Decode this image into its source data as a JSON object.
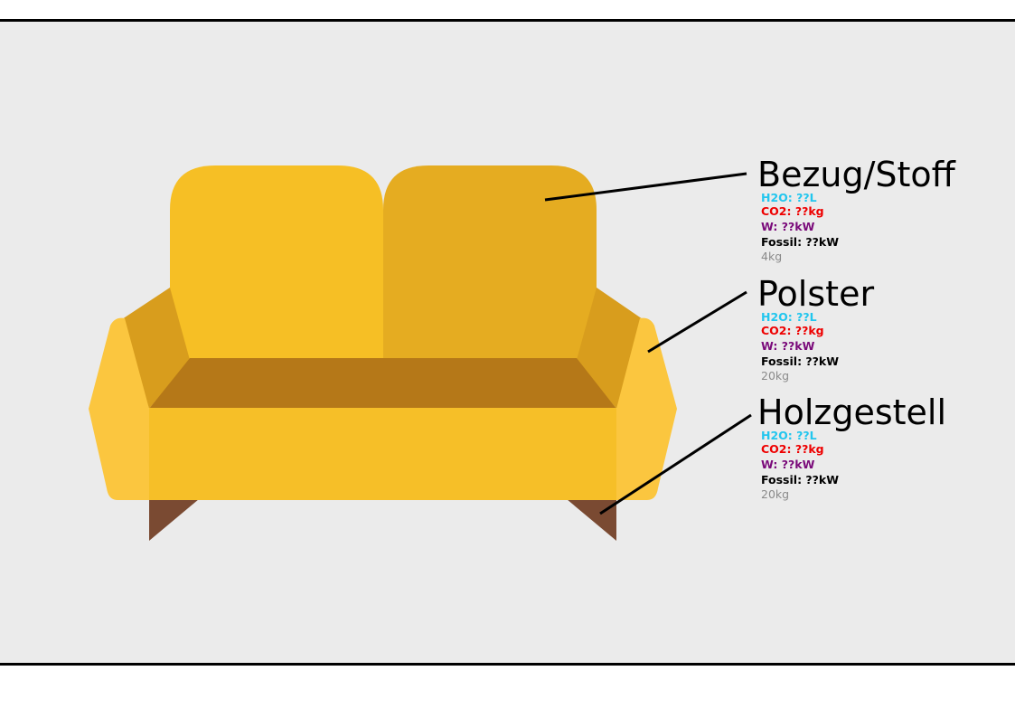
{
  "colors": {
    "background": "#ebebeb",
    "frame": "#000000",
    "h2o": "#22c6ee",
    "co2": "#ee0000",
    "w": "#7a0a7a",
    "fossil": "#000000",
    "weight": "#8a8a8a",
    "sofa_back_left": "#f6bf25",
    "sofa_back_right": "#e5ac21",
    "sofa_arm_side": "#d89d1d",
    "sofa_arm_front": "#fbc63f",
    "sofa_seat": "#b57818",
    "sofa_front": "#f6bf28",
    "sofa_legs": "#7a4a32"
  },
  "parts": [
    {
      "title": "Bezug/Stoff",
      "h2o": "H2O: ??L",
      "co2": "CO2: ??kg",
      "w": "W: ??kW",
      "fossil": "Fossil: ??kW",
      "weight": "4kg"
    },
    {
      "title": "Polster",
      "h2o": "H2O: ??L",
      "co2": "CO2: ??kg",
      "w": "W: ??kW",
      "fossil": "Fossil: ??kW",
      "weight": "20kg"
    },
    {
      "title": "Holzgestell",
      "h2o": "H2O: ??L",
      "co2": "CO2: ??kg",
      "w": "W: ??kW",
      "fossil": "Fossil: ??kW",
      "weight": "20kg"
    }
  ]
}
